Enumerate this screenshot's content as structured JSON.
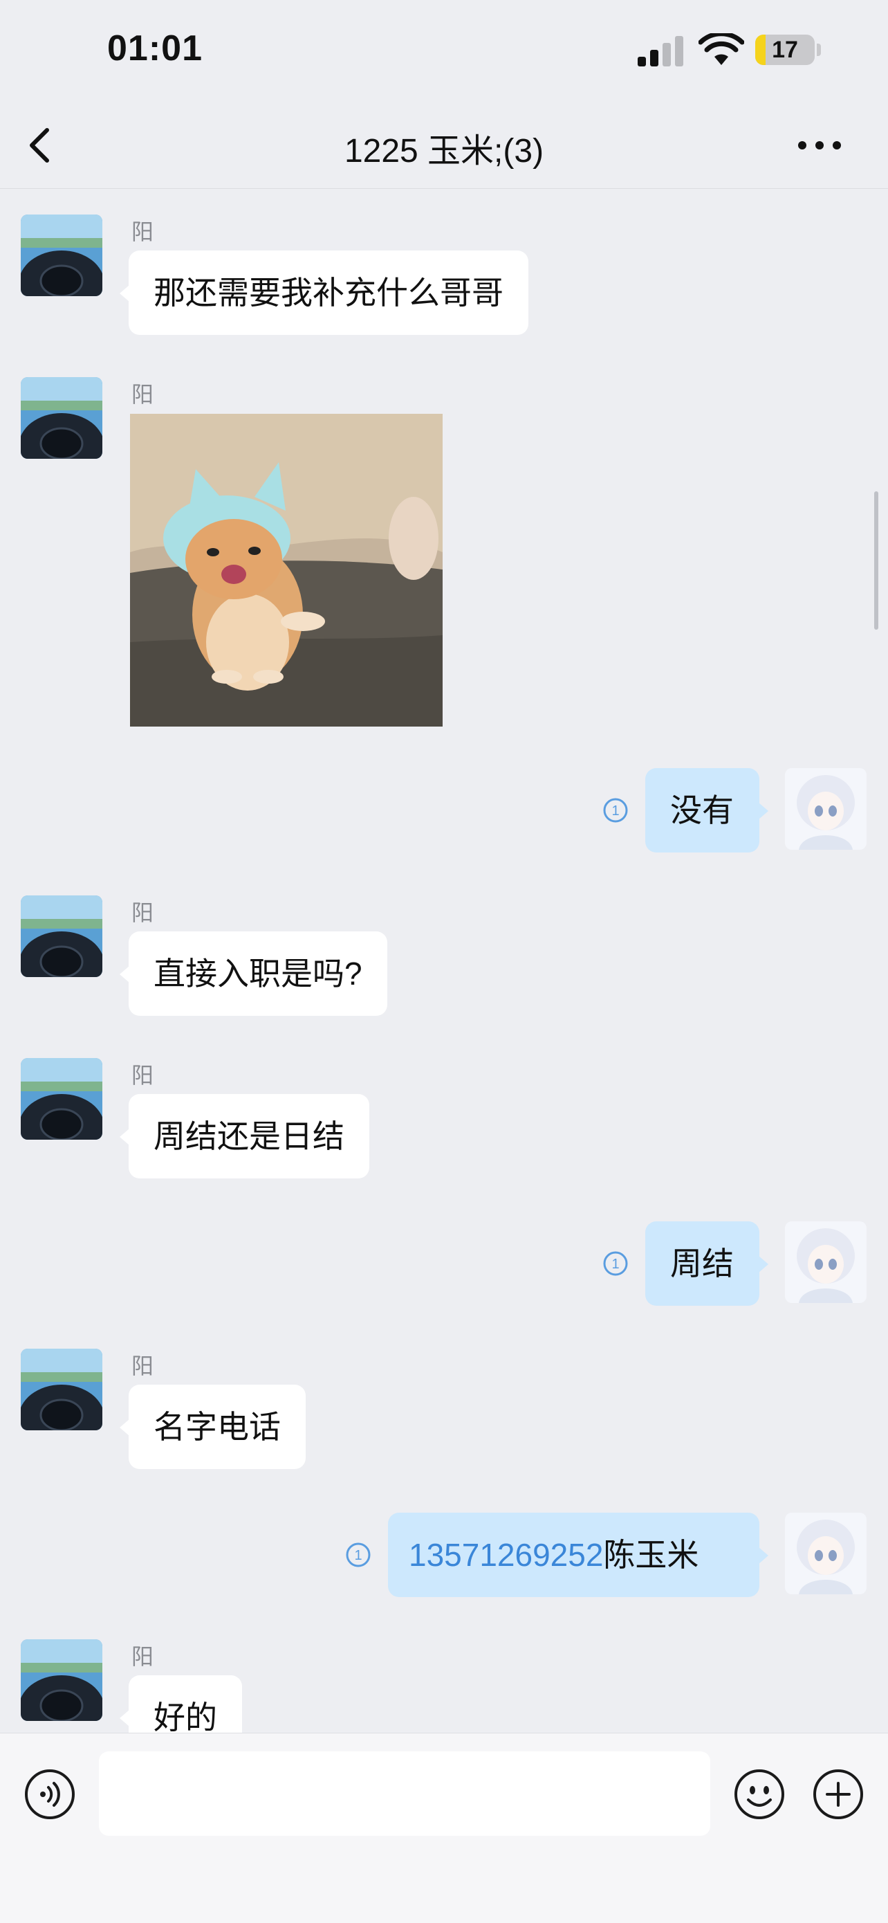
{
  "status_bar": {
    "time": "01:01",
    "battery": "17",
    "battery_level": 0.17
  },
  "header": {
    "title": "1225 玉米;(3)"
  },
  "messages": [
    {
      "type": "incoming",
      "sender": "阳",
      "text": "那还需要我补充什么哥哥"
    },
    {
      "type": "incoming-sticker",
      "sender": "阳",
      "sticker": "kitten-sticker"
    },
    {
      "type": "outgoing",
      "text": "没有",
      "receipt": "1"
    },
    {
      "type": "incoming",
      "sender": "阳",
      "text": "直接入职是吗?"
    },
    {
      "type": "incoming",
      "sender": "阳",
      "text": "周结还是日结"
    },
    {
      "type": "outgoing",
      "text": "周结",
      "receipt": "1"
    },
    {
      "type": "incoming",
      "sender": "阳",
      "text": "名字电话"
    },
    {
      "type": "outgoing",
      "phone": "13571269252",
      "text": "陈玉米",
      "receipt": "1"
    },
    {
      "type": "incoming",
      "sender": "阳",
      "text": "好的"
    }
  ],
  "input": {
    "placeholder": "",
    "value": ""
  },
  "colors": {
    "background": "#edeef2",
    "incoming_bubble": "#ffffff",
    "outgoing_bubble": "#cde8fd",
    "link": "#3a86d8",
    "battery": "#f5d31c"
  },
  "icons": [
    "back-icon",
    "more-icon",
    "voice-icon",
    "emoji-icon",
    "add-icon",
    "read-receipt-icon",
    "signal-icon",
    "wifi-icon",
    "battery-icon"
  ]
}
